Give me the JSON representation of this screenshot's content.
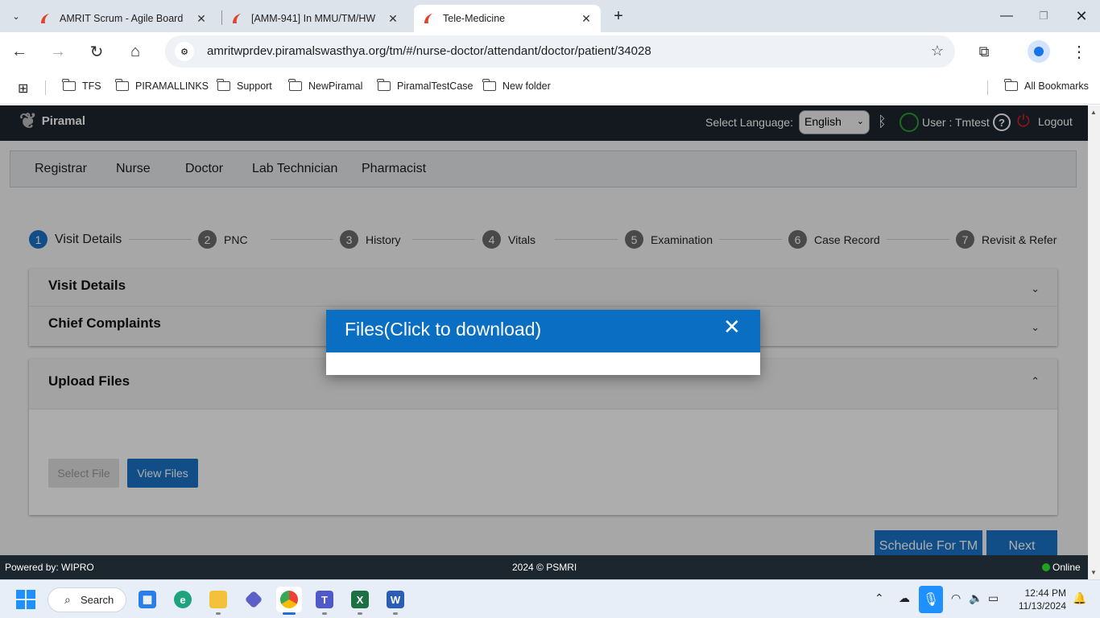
{
  "browser": {
    "tabs": [
      {
        "title": "AMRIT Scrum - Agile Board",
        "active": false
      },
      {
        "title": "[AMM-941] In MMU/TM/HW",
        "active": false
      },
      {
        "title": "Tele-Medicine",
        "active": true
      }
    ],
    "url": "amritwprdev.piramalswasthya.org/tm/#/nurse-doctor/attendant/doctor/patient/34028",
    "bookmarks": [
      "TFS",
      "PIRAMALLINKS",
      "Support",
      "NewPiramal",
      "PiramalTestCase",
      "New folder"
    ],
    "all_bookmarks": "All Bookmarks"
  },
  "app": {
    "brand": "Piramal",
    "language_label": "Select Language:",
    "language_value": "English",
    "user_label": "User : Tmtest",
    "logout_label": "Logout",
    "roles": [
      "Registrar",
      "Nurse",
      "Doctor",
      "Lab Technician",
      "Pharmacist"
    ],
    "steps": [
      {
        "num": "1",
        "label": "Visit Details",
        "active": true
      },
      {
        "num": "2",
        "label": "PNC"
      },
      {
        "num": "3",
        "label": "History"
      },
      {
        "num": "4",
        "label": "Vitals"
      },
      {
        "num": "5",
        "label": "Examination"
      },
      {
        "num": "6",
        "label": "Case Record"
      },
      {
        "num": "7",
        "label": "Revisit & Refer"
      }
    ],
    "panels": {
      "visit_details": "Visit Details",
      "chief_complaints": "Chief Complaints",
      "upload_files": "Upload Files"
    },
    "select_file_label": "Select File",
    "view_files_label": "View Files",
    "schedule_label": "Schedule For TM",
    "next_label": "Next",
    "footer": {
      "powered_by": "Powered by: WIPRO",
      "copyright": "2024 © PSMRI",
      "status": "Online"
    },
    "modal": {
      "title": "Files(Click to download)",
      "close_glyph": "✕"
    }
  },
  "taskbar": {
    "search_label": "Search",
    "time": "12:44 PM",
    "date": "11/13/2024"
  },
  "colors": {
    "primary": "#1a73c9",
    "header_bg": "#1c262e",
    "online": "#1fa31f"
  }
}
